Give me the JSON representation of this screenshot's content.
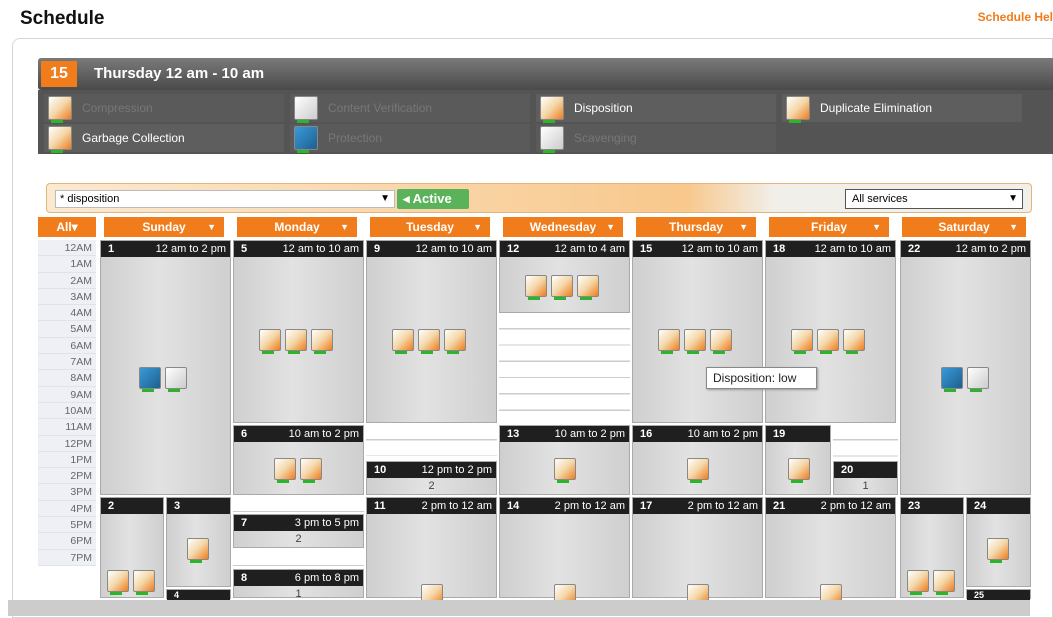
{
  "page": {
    "title": "Schedule",
    "help_link": "Schedule Hel"
  },
  "job": {
    "number": "15",
    "title": "Thursday 12 am - 10 am"
  },
  "services": [
    {
      "label": "Compression",
      "enabled": false
    },
    {
      "label": "Content Verification",
      "enabled": false
    },
    {
      "label": "Disposition",
      "enabled": true
    },
    {
      "label": "Duplicate Elimination",
      "enabled": true
    },
    {
      "label": "Garbage Collection",
      "enabled": true
    },
    {
      "label": "Protection",
      "enabled": false
    },
    {
      "label": "Scavenging",
      "enabled": false
    }
  ],
  "filter": {
    "selected": "* disposition",
    "status": "Active",
    "service_filter": "All services"
  },
  "days": {
    "all": "All",
    "names": [
      "Sunday",
      "Monday",
      "Tuesday",
      "Wednesday",
      "Thursday",
      "Friday",
      "Saturday"
    ]
  },
  "times": [
    "12AM",
    "1AM",
    "2AM",
    "3AM",
    "4AM",
    "5AM",
    "6AM",
    "7AM",
    "8AM",
    "9AM",
    "10AM",
    "11AM",
    "12PM",
    "1PM",
    "2PM",
    "3PM",
    "4PM",
    "5PM",
    "6PM",
    "7PM"
  ],
  "slots": [
    {
      "n": "1",
      "t": "12 am to 2 pm"
    },
    {
      "n": "5",
      "t": "12 am to 10 am"
    },
    {
      "n": "9",
      "t": "12 am to 10 am"
    },
    {
      "n": "12",
      "t": "12 am to 4 am"
    },
    {
      "n": "15",
      "t": "12 am to 10 am"
    },
    {
      "n": "18",
      "t": "12 am to 10 am"
    },
    {
      "n": "22",
      "t": "12 am to 2 pm"
    },
    {
      "n": "6",
      "t": "10 am to 2 pm"
    },
    {
      "n": "13",
      "t": "10 am to 2 pm"
    },
    {
      "n": "16",
      "t": "10 am to 2 pm"
    },
    {
      "n": "19",
      "t": ""
    },
    {
      "n": "10",
      "t": "12 pm to 2 pm",
      "sub": "2"
    },
    {
      "n": "20",
      "t": "",
      "sub": "1"
    },
    {
      "n": "2",
      "t": ""
    },
    {
      "n": "3",
      "t": ""
    },
    {
      "n": "7",
      "t": "3 pm to 5 pm",
      "sub": "2"
    },
    {
      "n": "8",
      "t": "6 pm to 8 pm",
      "sub": "1"
    },
    {
      "n": "11",
      "t": "2 pm to 12 am"
    },
    {
      "n": "14",
      "t": "2 pm to 12 am"
    },
    {
      "n": "17",
      "t": "2 pm to 12 am"
    },
    {
      "n": "21",
      "t": "2 pm to 12 am"
    },
    {
      "n": "23",
      "t": ""
    },
    {
      "n": "24",
      "t": ""
    },
    {
      "n": "4",
      "t": ""
    },
    {
      "n": "25",
      "t": ""
    }
  ],
  "tooltip": "Disposition: low"
}
